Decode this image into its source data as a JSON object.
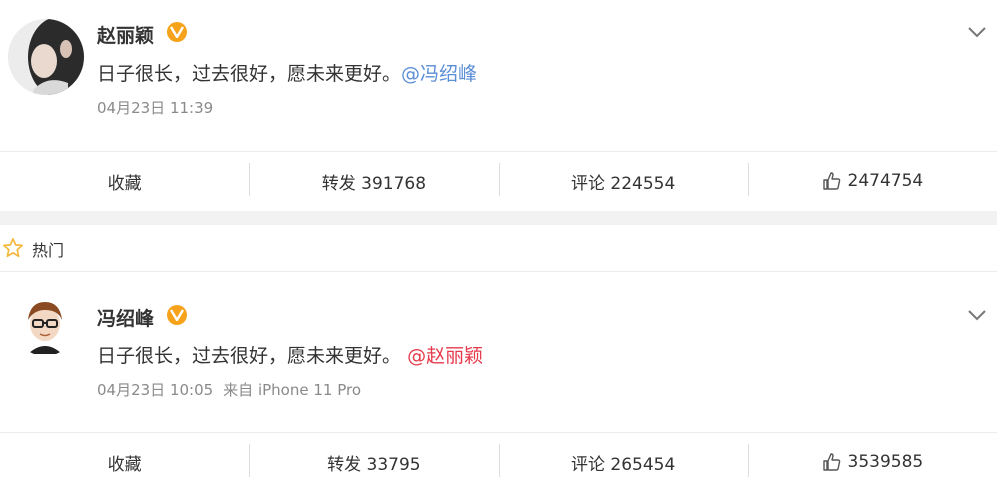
{
  "posts": [
    {
      "username": "赵丽颖",
      "content_text": "日子很长，过去很好，愿未来更好。",
      "mention": "@冯绍峰",
      "time": "04月23日 11:39",
      "source": "",
      "actions": {
        "favorite": "收藏",
        "repost": "转发 391768",
        "comment": "评论 224554",
        "like": "2474754"
      }
    },
    {
      "username": "冯绍峰",
      "content_text": "日子很长，过去很好，愿未来更好。",
      "mention": "@赵丽颖",
      "time": "04月23日 10:05",
      "source": "来自 iPhone 11 Pro",
      "actions": {
        "favorite": "收藏",
        "repost": "转发 33795",
        "comment": "评论 265454",
        "like": "3539585"
      }
    }
  ],
  "hot_section": {
    "label": "热门"
  },
  "colors": {
    "mention_blue": "#5b8ed6",
    "mention_red": "#e6394b",
    "verified_badge": "#f7a21b",
    "hot_star": "#f5b73b",
    "meta_gray": "#8a8a8a"
  },
  "icons": {
    "verified": "verified-v-icon",
    "dropdown": "chevron-down-icon",
    "like": "thumbs-up-icon",
    "hot": "star-outline-icon"
  }
}
